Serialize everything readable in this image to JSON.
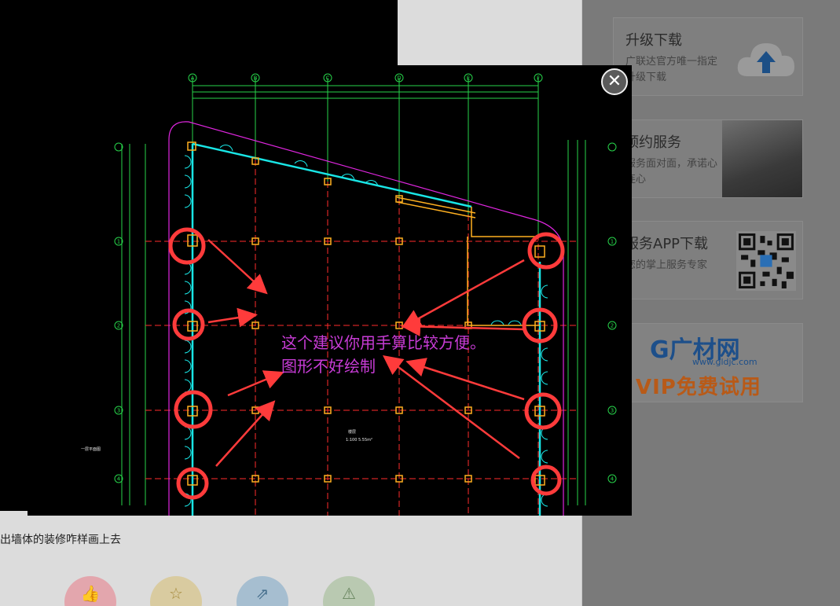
{
  "question": {
    "text": "出墙体的装修咋样画上去"
  },
  "actions": {
    "like_icon": "thumbs-up-icon",
    "favorite_icon": "star-icon",
    "share_icon": "share-icon",
    "report_icon": "warning-icon"
  },
  "sidebar": {
    "upgrade": {
      "title": "升级下载",
      "desc": "广联达官方唯一指定升级下载",
      "icon": "cloud-upload-icon"
    },
    "booking": {
      "title": "预约服务",
      "desc": "服务面对面，承诺心连心"
    },
    "app": {
      "title": "服务APP下载",
      "desc": "您的掌上服务专家"
    },
    "gldjc": {
      "logo": "G广材网",
      "url": "www.gldjc.com",
      "promo": "VIP免费试用"
    }
  },
  "lightbox": {
    "annotation_line1": "这个建议你用手算比较方便。",
    "annotation_line2": "图形不好绘制",
    "axis_labels_top": [
      "A",
      "B",
      "C",
      "D",
      "E",
      "F"
    ],
    "axis_labels_side": [
      "1",
      "2",
      "3",
      "4"
    ],
    "close_symbol": "✕"
  },
  "colors": {
    "annotation": "#c83cd6",
    "marker_red": "#ff3b3b",
    "cad_green": "#27d34a",
    "cad_cyan": "#19e6e6"
  }
}
